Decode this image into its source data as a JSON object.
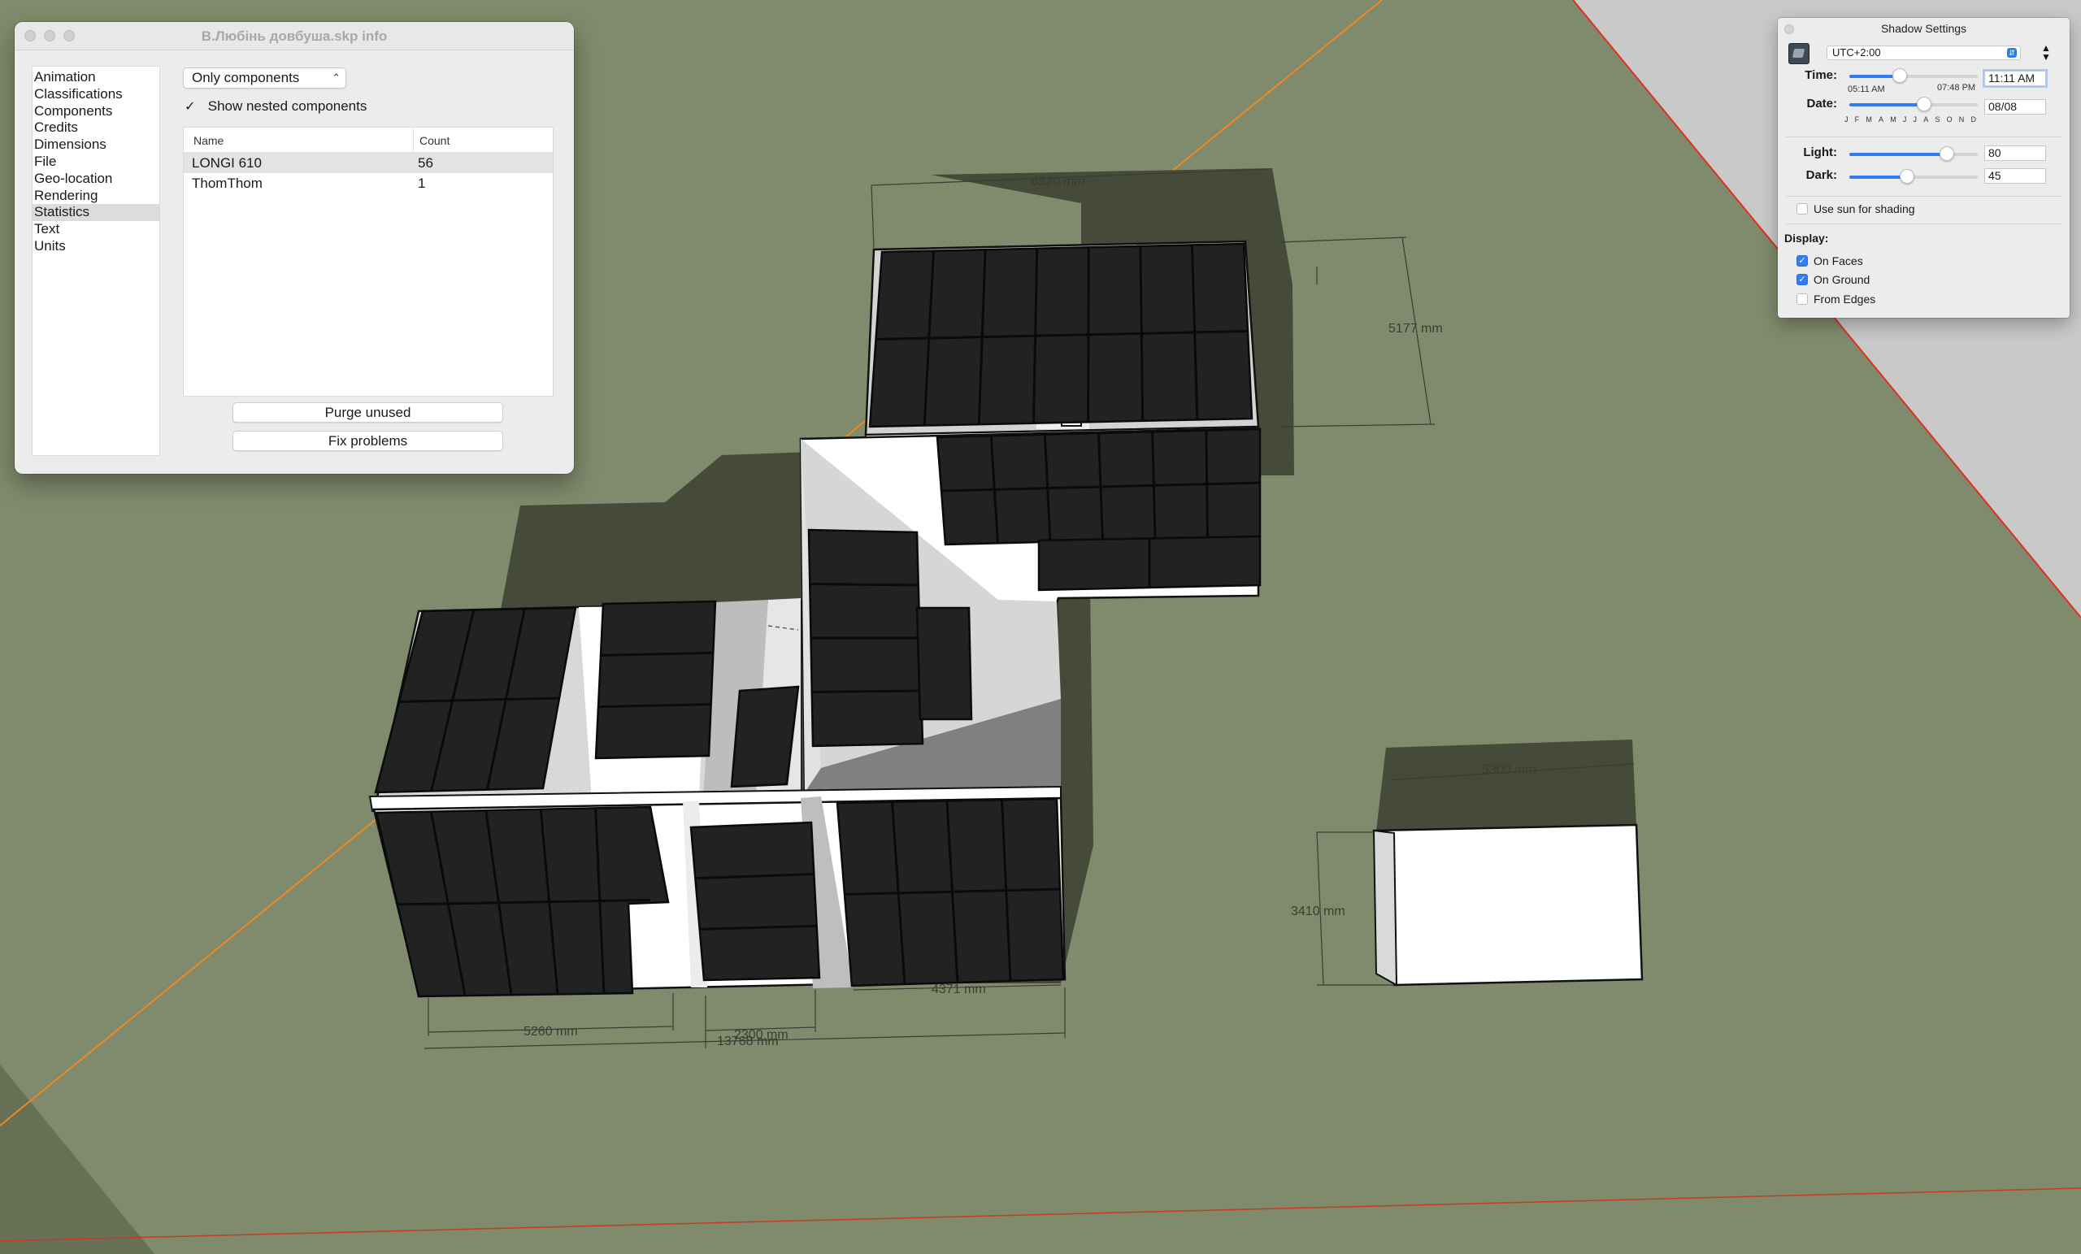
{
  "model_info": {
    "title": "В.Любінь довбуша.skp info",
    "categories": [
      "Animation",
      "Classifications",
      "Components",
      "Credits",
      "Dimensions",
      "File",
      "Geo-location",
      "Rendering",
      "Statistics",
      "Text",
      "Units"
    ],
    "selected_category": "Statistics",
    "filter_select": "Only components",
    "show_nested_label": "Show nested components",
    "show_nested_checked": true,
    "table": {
      "col_name": "Name",
      "col_count": "Count",
      "rows": [
        {
          "name": "LONGI 610",
          "count": "56"
        },
        {
          "name": "ThomThom",
          "count": "1"
        }
      ]
    },
    "purge_label": "Purge unused",
    "fix_label": "Fix problems"
  },
  "shadow": {
    "title": "Shadow Settings",
    "timezone": "UTC+2:00",
    "time_label": "Time:",
    "time_value": "11:11 AM",
    "sunrise": "05:11 AM",
    "sunset": "07:48 PM",
    "time_slider": 0.39,
    "date_label": "Date:",
    "date_value": "08/08",
    "date_slider": 0.58,
    "months": [
      "J",
      "F",
      "M",
      "A",
      "M",
      "J",
      "J",
      "A",
      "S",
      "O",
      "N",
      "D"
    ],
    "light_label": "Light:",
    "light_value": "80",
    "light_slider": 0.76,
    "dark_label": "Dark:",
    "dark_value": "45",
    "dark_slider": 0.45,
    "use_sun_label": "Use sun for shading",
    "use_sun_checked": false,
    "display_label": "Display:",
    "on_faces_label": "On Faces",
    "on_faces_checked": true,
    "on_ground_label": "On Ground",
    "on_ground_checked": true,
    "from_edges_label": "From Edges",
    "from_edges_checked": false
  },
  "dimensions": {
    "d_top": "6520 mm",
    "d_right": "5177 mm",
    "d_small_top": "5300 mm",
    "d_small_height": "3410 mm",
    "d_a": "5260 mm",
    "d_b": "2300 mm",
    "d_total": "13768 mm",
    "d_c": "4371 mm"
  },
  "colors": {
    "ground": "#808a6c",
    "shadow": "#454a39",
    "panel": "#222222",
    "wall": "#ffffff",
    "accent": "#2f7cf6",
    "axis_green": "#f0891e",
    "axis_red": "#e0301e"
  }
}
